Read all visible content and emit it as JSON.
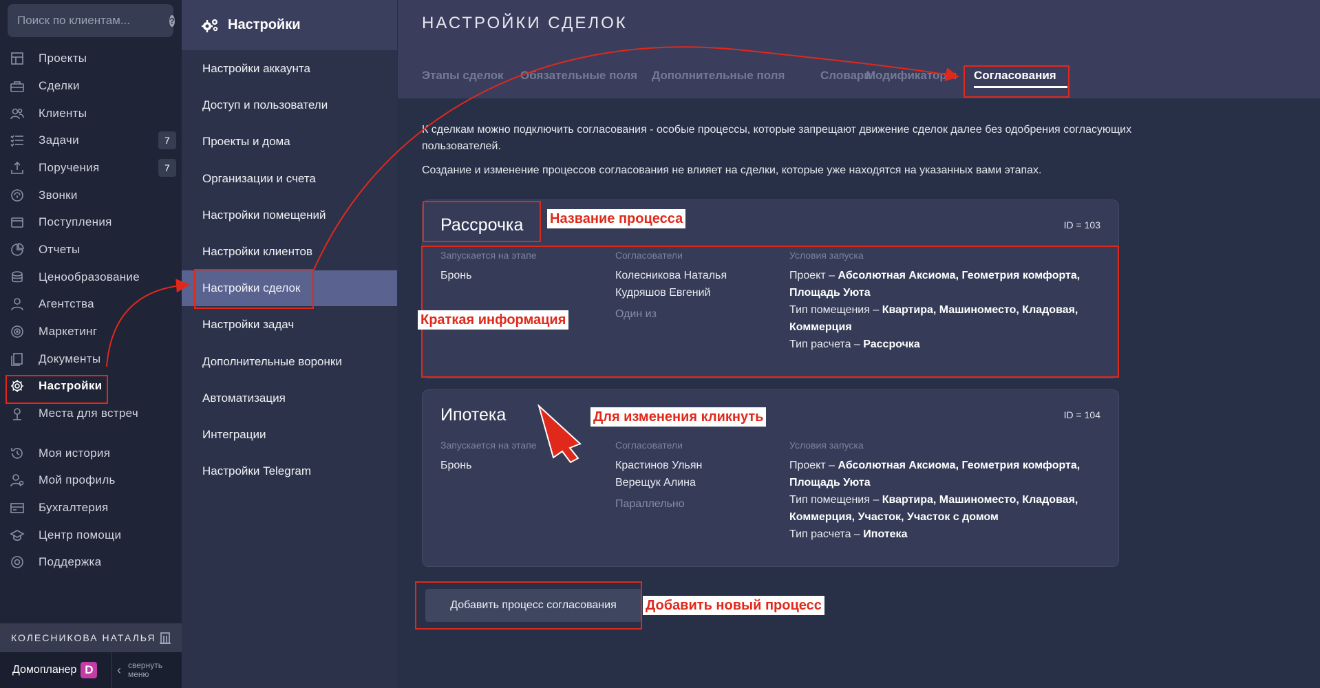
{
  "search": {
    "placeholder": "Поиск по клиентам..."
  },
  "nav": [
    {
      "label": "Проекты",
      "icon": "projects-icon",
      "badge": ""
    },
    {
      "label": "Сделки",
      "icon": "deals-icon",
      "badge": ""
    },
    {
      "label": "Клиенты",
      "icon": "clients-icon",
      "badge": ""
    },
    {
      "label": "Задачи",
      "icon": "tasks-icon",
      "badge": "7"
    },
    {
      "label": "Поручения",
      "icon": "assignments-icon",
      "badge": "7"
    },
    {
      "label": "Звонки",
      "icon": "calls-icon",
      "badge": ""
    },
    {
      "label": "Поступления",
      "icon": "receipts-icon",
      "badge": ""
    },
    {
      "label": "Отчеты",
      "icon": "reports-icon",
      "badge": ""
    },
    {
      "label": "Ценообразование",
      "icon": "pricing-icon",
      "badge": ""
    },
    {
      "label": "Агентства",
      "icon": "agencies-icon",
      "badge": ""
    },
    {
      "label": "Маркетинг",
      "icon": "marketing-icon",
      "badge": ""
    },
    {
      "label": "Документы",
      "icon": "documents-icon",
      "badge": ""
    },
    {
      "label": "Настройки",
      "icon": "gear-icon",
      "badge": ""
    },
    {
      "label": "Места для встреч",
      "icon": "meeting-places-icon",
      "badge": ""
    },
    {
      "label": "Моя история",
      "icon": "history-icon",
      "badge": ""
    },
    {
      "label": "Мой профиль",
      "icon": "profile-icon",
      "badge": ""
    },
    {
      "label": "Бухгалтерия",
      "icon": "accounting-icon",
      "badge": ""
    },
    {
      "label": "Центр помощи",
      "icon": "help-center-icon",
      "badge": ""
    },
    {
      "label": "Поддержка",
      "icon": "support-icon",
      "badge": ""
    }
  ],
  "nav_active": "Настройки",
  "user": {
    "name": "КОЛЕСНИКОВА НАТАЛЬЯ"
  },
  "brand": {
    "name": "Домопланер",
    "logo_letter": "D",
    "collapse_line1": "свернуть",
    "collapse_line2": "меню"
  },
  "settings": {
    "title": "Настройки",
    "items": [
      "Настройки аккаунта",
      "Доступ и пользователи",
      "Проекты и дома",
      "Организации и счета",
      "Настройки помещений",
      "Настройки клиентов",
      "Настройки сделок",
      "Настройки задач",
      "Дополнительные воронки",
      "Автоматизация",
      "Интеграции",
      "Настройки Telegram"
    ],
    "active": "Настройки сделок"
  },
  "main": {
    "title": "НАСТРОЙКИ СДЕЛОК",
    "tabs": [
      "Этапы сделок",
      "Обязательные поля",
      "Дополнительные поля",
      "Словари",
      "Модификаторы",
      "Согласования"
    ],
    "active_tab": "Согласования",
    "intro1": "К сделкам можно подключить согласования - особые процессы, которые запрещают движение сделок далее без одобрения согласующих пользователей.",
    "intro2": "Создание и изменение процессов согласования не влияет на сделки, которые уже находятся на указанных вами этапах.",
    "labels": {
      "stage": "Запускается на этапе",
      "approvers": "Согласователи",
      "conditions": "Условия запуска"
    },
    "processes": [
      {
        "name": "Рассрочка",
        "id": "ID = 103",
        "stage": "Бронь",
        "approvers": [
          "Колесникова Наталья",
          "Кудряшов Евгений"
        ],
        "mode": "Один из",
        "conditions": [
          {
            "key": "Проект – ",
            "value": "Абсолютная Аксиома, Геометрия комфорта, Площадь Уюта"
          },
          {
            "key": "Тип помещения – ",
            "value": "Квартира, Машиноместо, Кладовая, Коммерция"
          },
          {
            "key": "Тип расчета – ",
            "value": "Рассрочка"
          }
        ]
      },
      {
        "name": "Ипотека",
        "id": "ID = 104",
        "stage": "Бронь",
        "approvers": [
          "Крастинов Ульян",
          "Верещук Алина"
        ],
        "mode": "Параллельно",
        "conditions": [
          {
            "key": "Проект – ",
            "value": "Абсолютная Аксиома, Геометрия комфорта, Площадь Уюта"
          },
          {
            "key": "Тип помещения – ",
            "value": "Квартира, Машиноместо, Кладовая, Коммерция, Участок, Участок с домом"
          },
          {
            "key": "Тип расчета – ",
            "value": "Ипотека"
          }
        ]
      }
    ],
    "add_button": "Добавить процесс согласования"
  },
  "annotations": {
    "process_name": "Название процесса",
    "brief_info": "Краткая информация",
    "click_to_edit": "Для изменения кликнуть",
    "add_new": "Добавить новый процесс"
  },
  "colors": {
    "accent_red": "#e0291b",
    "active_item": "#5a6390",
    "brand_logo": "#c43ca6"
  }
}
